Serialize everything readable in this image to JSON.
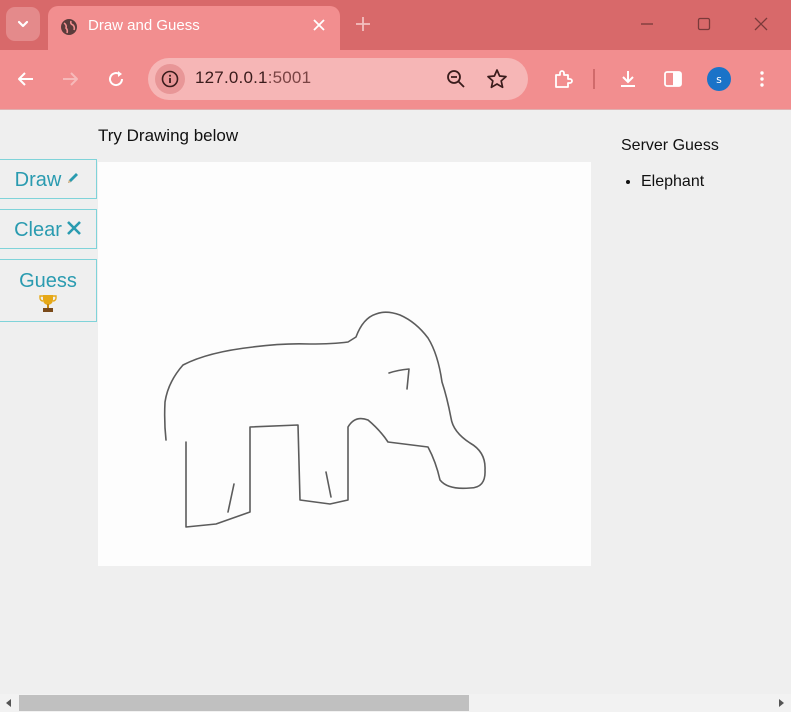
{
  "browser": {
    "tab_title": "Draw and Guess",
    "url_host": "127.0.0.1",
    "url_port": ":5001",
    "profile_initial": "s"
  },
  "page": {
    "heading": "Try Drawing below",
    "buttons": {
      "draw": "Draw",
      "clear": "Clear",
      "guess": "Guess"
    },
    "server_guess": {
      "title": "Server Guess",
      "items": [
        "Elephant"
      ]
    }
  },
  "colors": {
    "titlebar": "#d8696a",
    "toolbar": "#f28e8f",
    "accent": "#2a9bb0",
    "canvas": "#fdfdfd"
  },
  "icons": {
    "draw": "pencil-icon",
    "clear": "close-x-icon",
    "guess": "trophy-icon"
  }
}
